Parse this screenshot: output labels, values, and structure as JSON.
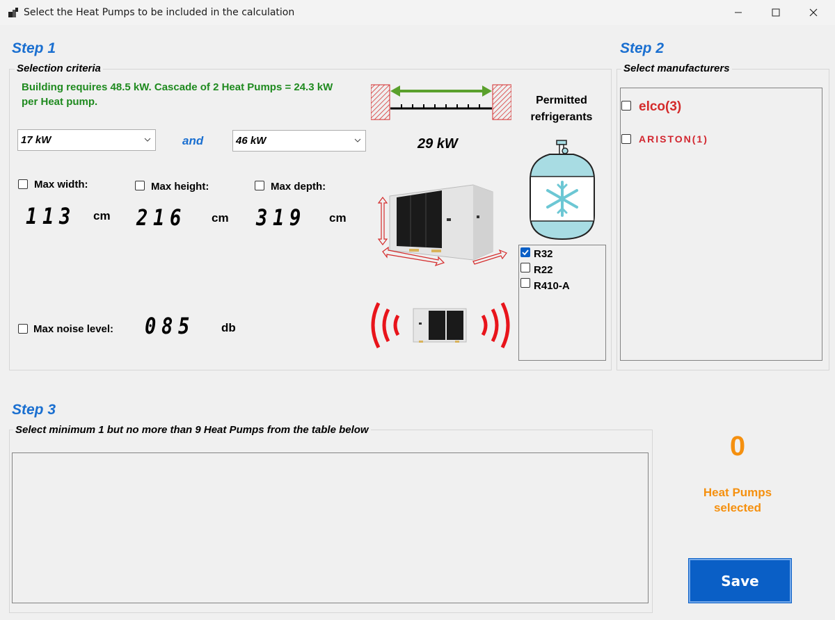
{
  "window": {
    "title": "Select the Heat Pumps to be included in the calculation"
  },
  "step1": {
    "title": "Step 1",
    "group_label": "Selection criteria",
    "requirement_line1": "Building requires 48.5 kW. Cascade of 2 Heat Pumps = 24.3 kW",
    "requirement_line2": "per Heat pump.",
    "min_power": "17 kW",
    "and_label": "and",
    "max_power": "46 kW",
    "power_range": "29 kW",
    "max_width": {
      "label": "Max width:",
      "value": "113",
      "unit": "cm",
      "checked": false
    },
    "max_height": {
      "label": "Max height:",
      "value": "216",
      "unit": "cm",
      "checked": false
    },
    "max_depth": {
      "label": "Max depth:",
      "value": "319",
      "unit": "cm",
      "checked": false
    },
    "max_noise": {
      "label": "Max noise level:",
      "value": "085",
      "unit": "db",
      "checked": false
    },
    "permitted_line1": "Permitted",
    "permitted_line2": "refrigerants",
    "refrigerants": [
      {
        "label": "R32",
        "checked": true
      },
      {
        "label": "R22",
        "checked": false
      },
      {
        "label": "R410-A",
        "checked": false
      }
    ]
  },
  "step2": {
    "title": "Step 2",
    "group_label": "Select manufacturers",
    "manufacturers": [
      {
        "label": "elco(3)",
        "checked": false
      },
      {
        "label": "ARISTON(1)",
        "checked": false
      }
    ]
  },
  "step3": {
    "title": "Step 3",
    "group_label": "Select minimum 1 but no more than 9 Heat Pumps from the table below",
    "selected_count": "0",
    "selected_line1": "Heat Pumps",
    "selected_line2": "selected",
    "save_label": "Save"
  },
  "colors": {
    "accent_blue": "#1a6fd0",
    "green": "#1f8a1f",
    "orange": "#f5900f",
    "button_blue": "#0a5fc6"
  },
  "icons": [
    "app-icon",
    "minimize-icon",
    "maximize-icon",
    "close-icon",
    "chevron-down-icon",
    "range-arrow-icon",
    "heat-pump-icon",
    "refrigerant-tank-icon",
    "snowflake-icon",
    "noise-waves-icon"
  ]
}
